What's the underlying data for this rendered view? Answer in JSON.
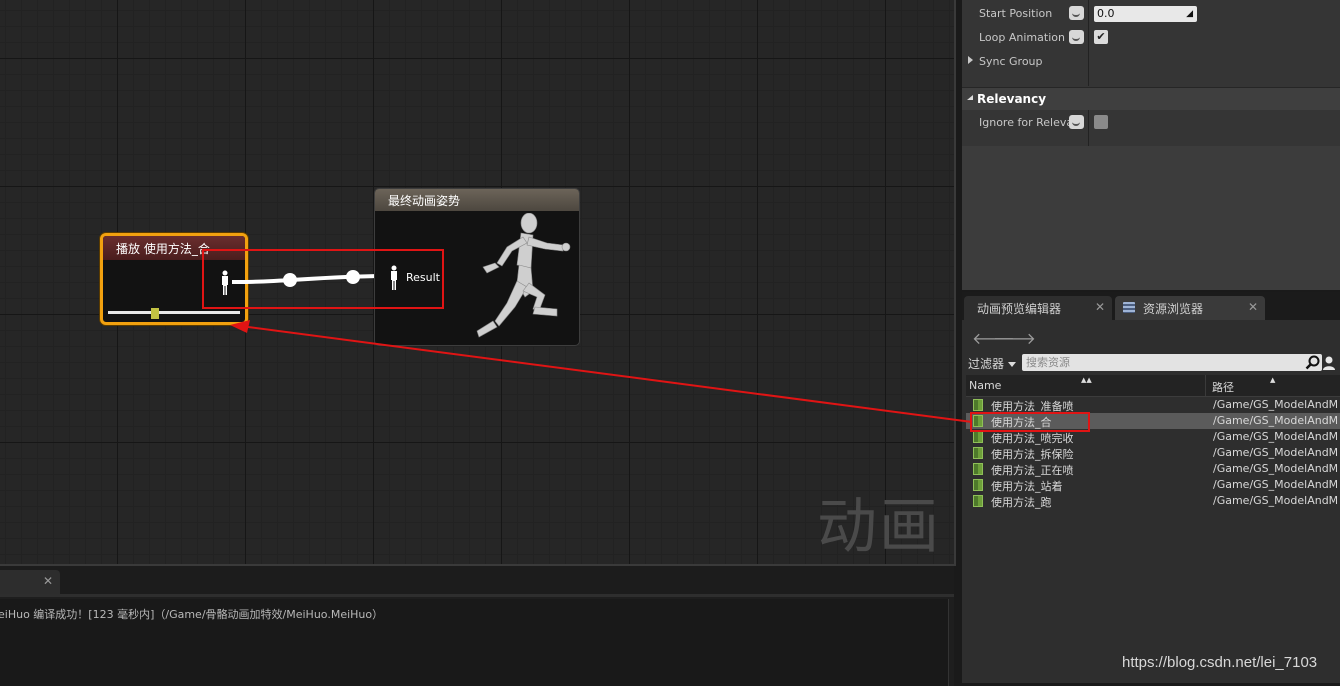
{
  "graph": {
    "watermark": "动画",
    "play_node": {
      "title": "播放 使用方法_合"
    },
    "output_node": {
      "title": "最终动画姿势",
      "pin_label": "Result"
    }
  },
  "log": {
    "message": "eiHuo 编译成功！[123 毫秒内]（/Game/骨骼动画加特效/MeiHuo.MeiHuo）"
  },
  "details": {
    "rows": [
      {
        "label": "Start Position",
        "value": "0.0"
      },
      {
        "label": "Loop Animation",
        "checked": true
      },
      {
        "label": "Sync Group"
      }
    ],
    "relevancy": {
      "header": "Relevancy",
      "rows": [
        {
          "label": "Ignore for Relevan",
          "checked": false
        }
      ]
    }
  },
  "tabs": [
    {
      "label": "动画预览编辑器"
    },
    {
      "label": "资源浏览器"
    }
  ],
  "content_browser": {
    "filter_label": "过滤器",
    "search_placeholder": "搜索资源",
    "columns": {
      "name": "Name",
      "path": "路径"
    },
    "assets": [
      {
        "name": "使用方法_准备喷",
        "path": "/Game/GS_ModelAndM"
      },
      {
        "name": "使用方法_合",
        "path": "/Game/GS_ModelAndM",
        "selected": true
      },
      {
        "name": "使用方法_喷完收",
        "path": "/Game/GS_ModelAndM"
      },
      {
        "name": "使用方法_拆保险",
        "path": "/Game/GS_ModelAndM"
      },
      {
        "name": "使用方法_正在喷",
        "path": "/Game/GS_ModelAndM"
      },
      {
        "name": "使用方法_站着",
        "path": "/Game/GS_ModelAndM"
      },
      {
        "name": "使用方法_跑",
        "path": "/Game/GS_ModelAndM"
      }
    ]
  },
  "site_watermark": "https://blog.csdn.net/lei_7103",
  "colors": {
    "selection_box": "#e01414",
    "node_border": "#f2a10f"
  }
}
